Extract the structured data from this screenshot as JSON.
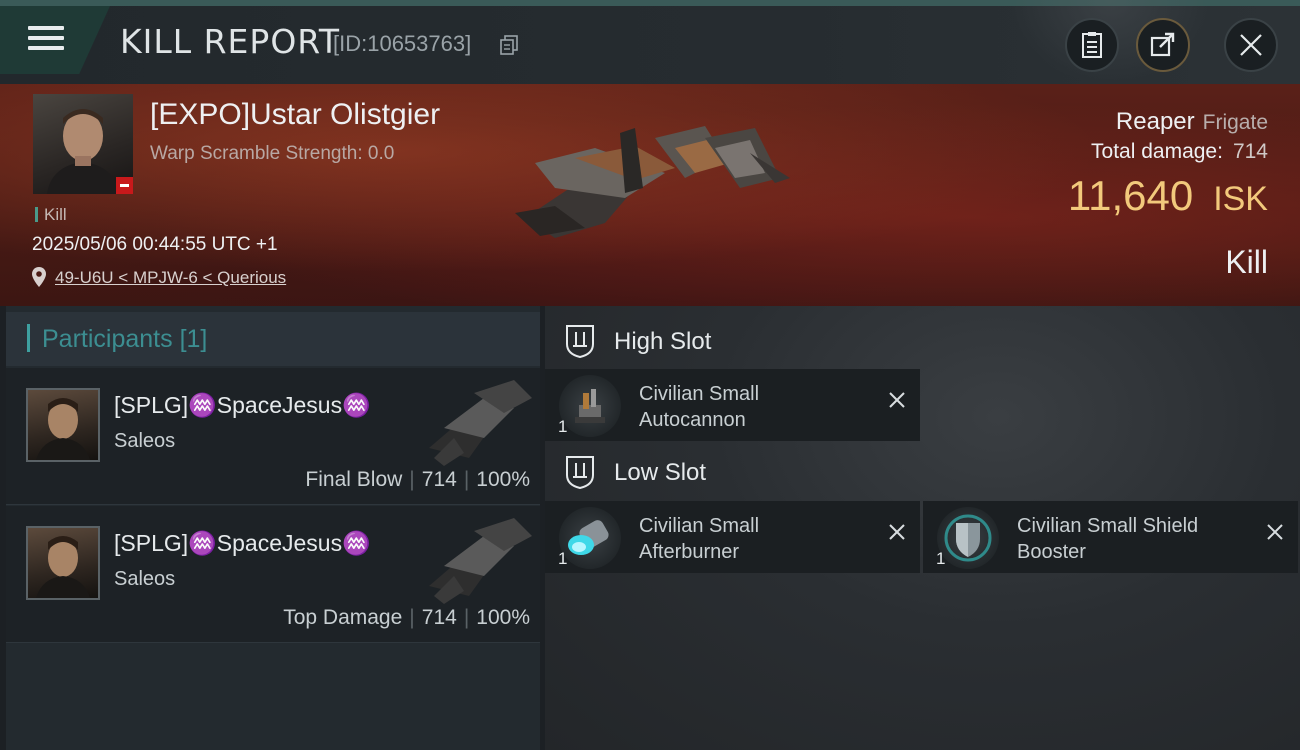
{
  "header": {
    "title": "KILL REPORT",
    "report_id": "[ID:10653763]"
  },
  "victim": {
    "name": "[EXPO]Ustar Olistgier",
    "scramble": "Warp Scramble Strength: 0.0",
    "kill_tag": "Kill",
    "datetime": "2025/05/06 00:44:55 UTC +1",
    "location": "49-U6U < MPJW-6 < Querious",
    "ship": "Reaper",
    "ship_class": "Frigate",
    "total_damage_label": "Total damage:",
    "total_damage": "714",
    "isk_value": "11,640",
    "isk_unit": "ISK",
    "result": "Kill"
  },
  "participants": {
    "label": "Participants",
    "count": "[1]",
    "rows": [
      {
        "name": "[SPLG]♒SpaceJesus♒",
        "ship": "Saleos",
        "role": "Final Blow",
        "damage": "714",
        "percent": "100%"
      },
      {
        "name": "[SPLG]♒SpaceJesus♒",
        "ship": "Saleos",
        "role": "Top Damage",
        "damage": "714",
        "percent": "100%"
      }
    ]
  },
  "fitting": {
    "high": {
      "label": "High Slot",
      "modules": [
        {
          "qty": "1",
          "name_line1": "Civilian Small",
          "name_line2": "Autocannon",
          "icon": "autocannon-icon"
        }
      ]
    },
    "low": {
      "label": "Low Slot",
      "modules": [
        {
          "qty": "1",
          "name_line1": "Civilian Small",
          "name_line2": "Afterburner",
          "icon": "afterburner-icon"
        },
        {
          "qty": "1",
          "name_line1": "Civilian Small Shield",
          "name_line2": "Booster",
          "icon": "shield-booster-icon"
        }
      ]
    }
  },
  "colors": {
    "accent": "#3ea0a0",
    "isk": "#f2c97c",
    "standing_bad": "#c8191b"
  }
}
